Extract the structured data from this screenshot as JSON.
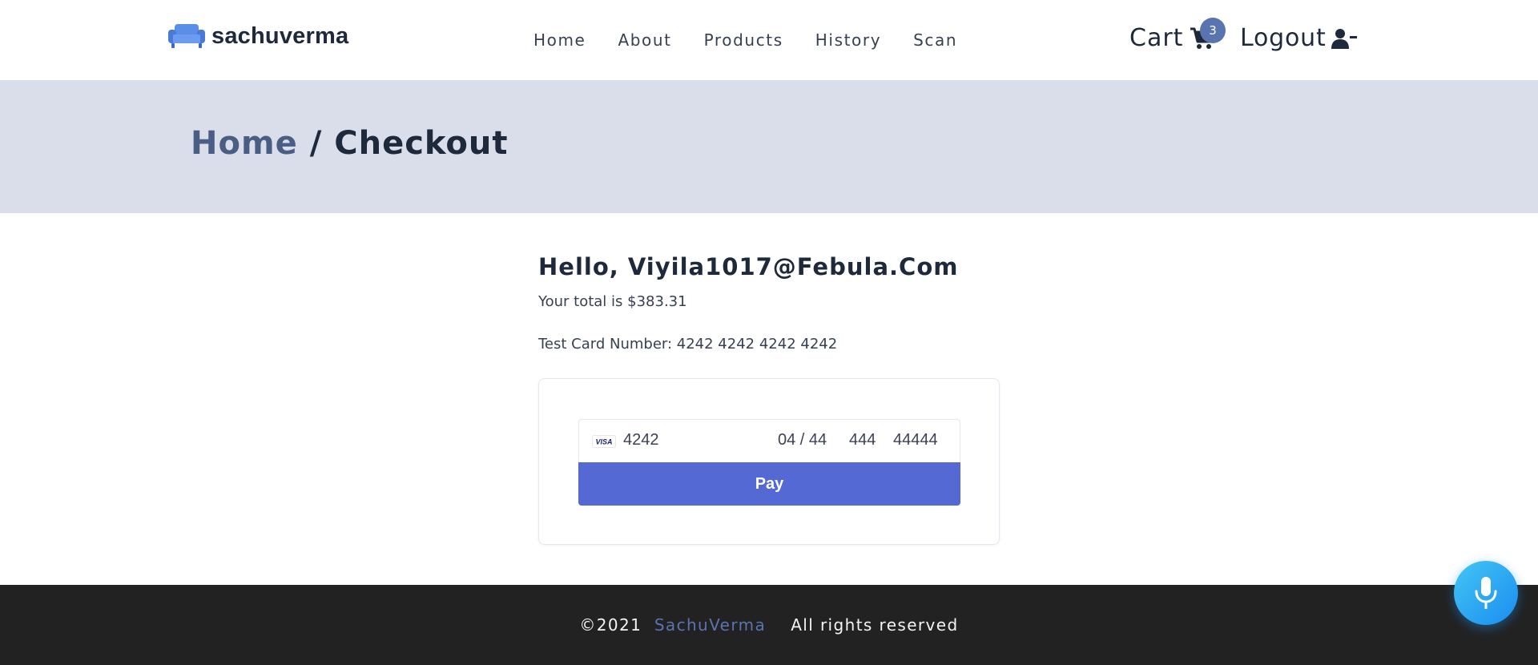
{
  "header": {
    "brand": "sachuverma",
    "nav": [
      {
        "label": "Home"
      },
      {
        "label": "About"
      },
      {
        "label": "Products"
      },
      {
        "label": "History"
      },
      {
        "label": "Scan"
      }
    ],
    "cart_label": "Cart",
    "cart_count": "3",
    "logout_label": "Logout"
  },
  "breadcrumb": {
    "home": "Home",
    "separator": " / ",
    "current": "Checkout"
  },
  "checkout": {
    "greeting": "Hello, Viyila1017@Febula.Com",
    "total": "Your total is $383.31",
    "test_card": "Test Card Number: 4242 4242 4242 4242",
    "card_number": "4242",
    "expiry": "04 / 44",
    "cvc": "444",
    "zip": "44444",
    "pay_label": "Pay"
  },
  "footer": {
    "copyright": "©2021",
    "author": "SachuVerma",
    "rights": "All rights reserved"
  },
  "colors": {
    "accent": "#5a74b0",
    "band": "#d9deea",
    "pay_button": "#5469d4",
    "footer_bg": "#222222",
    "mic": "#1a8df0"
  },
  "icons": [
    "sofa-icon",
    "cart-icon",
    "user-minus-icon",
    "visa-icon",
    "microphone-icon"
  ]
}
